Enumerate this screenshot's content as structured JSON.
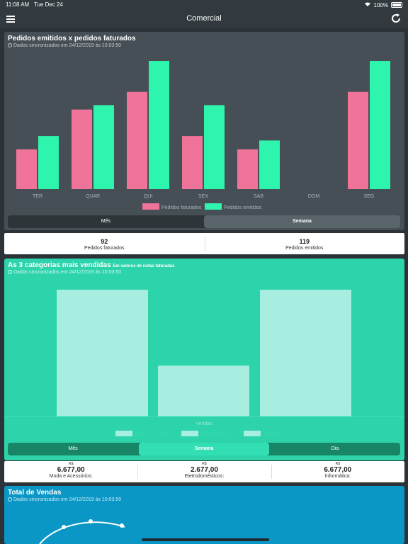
{
  "status_bar": {
    "time": "11:08 AM",
    "date": "Tue Dec 24",
    "battery": "100%"
  },
  "nav": {
    "title": "Comercial"
  },
  "card1": {
    "title": "Pedidos emitidos x pedidos faturados",
    "sync": "Dados sincronizados em 24/12/2019 às 10:03:50",
    "tabs": [
      {
        "label": "Mês",
        "active": false
      },
      {
        "label": "Semana",
        "active": true
      }
    ],
    "stats": [
      {
        "value": "92",
        "label": "Pedidos faturados"
      },
      {
        "value": "119",
        "label": "Pedidos emitidos"
      }
    ]
  },
  "card2": {
    "title": "As 3 categorias mais vendidas",
    "subtitle": "Em valores de notas faturadas",
    "sync": "Dados sincronizados em 24/12/2019 às 10:03:50",
    "tabs": [
      {
        "label": "Mês",
        "active": false
      },
      {
        "label": "Semana",
        "active": true
      },
      {
        "label": "Dia",
        "active": false
      }
    ],
    "stats": [
      {
        "currency": "R$",
        "value": "6.677,00",
        "label": "Moda e Acessórios:"
      },
      {
        "currency": "R$",
        "value": "2.677,00",
        "label": "Eletrodomésticos:"
      },
      {
        "currency": "R$",
        "value": "6.677,00",
        "label": "Informática:"
      }
    ]
  },
  "card3": {
    "title": "Total de Vendas",
    "sync": "Dados sincronizados em 24/12/2019 às 10:03:50"
  },
  "colors": {
    "faturados": "#f07399",
    "emitidos": "#2ef5ad",
    "card1_bg": "#464f55",
    "card2_bg": "#2dd3ab",
    "card3_bg": "#0b97c5"
  },
  "chart_data": [
    {
      "type": "bar",
      "categories": [
        "TER",
        "QUAR",
        "QUI",
        "SEX",
        "SAB",
        "DOM",
        "SEG"
      ],
      "series": [
        {
          "name": "Pedidos faturados",
          "values": [
            9,
            18,
            22,
            12,
            9,
            0,
            22
          ]
        },
        {
          "name": "Pedidos emitidos",
          "values": [
            12,
            19,
            29,
            19,
            11,
            0,
            29
          ]
        }
      ],
      "legend": "bottom"
    },
    {
      "type": "bar",
      "categories": [
        "Moda e Acessórios",
        "Eletrodomésticos",
        "Informática"
      ],
      "series": [
        {
          "name": "Vendas",
          "values": [
            6677,
            2677,
            6677
          ]
        }
      ],
      "xlabel": "Vendas",
      "legend": "bottom"
    }
  ]
}
